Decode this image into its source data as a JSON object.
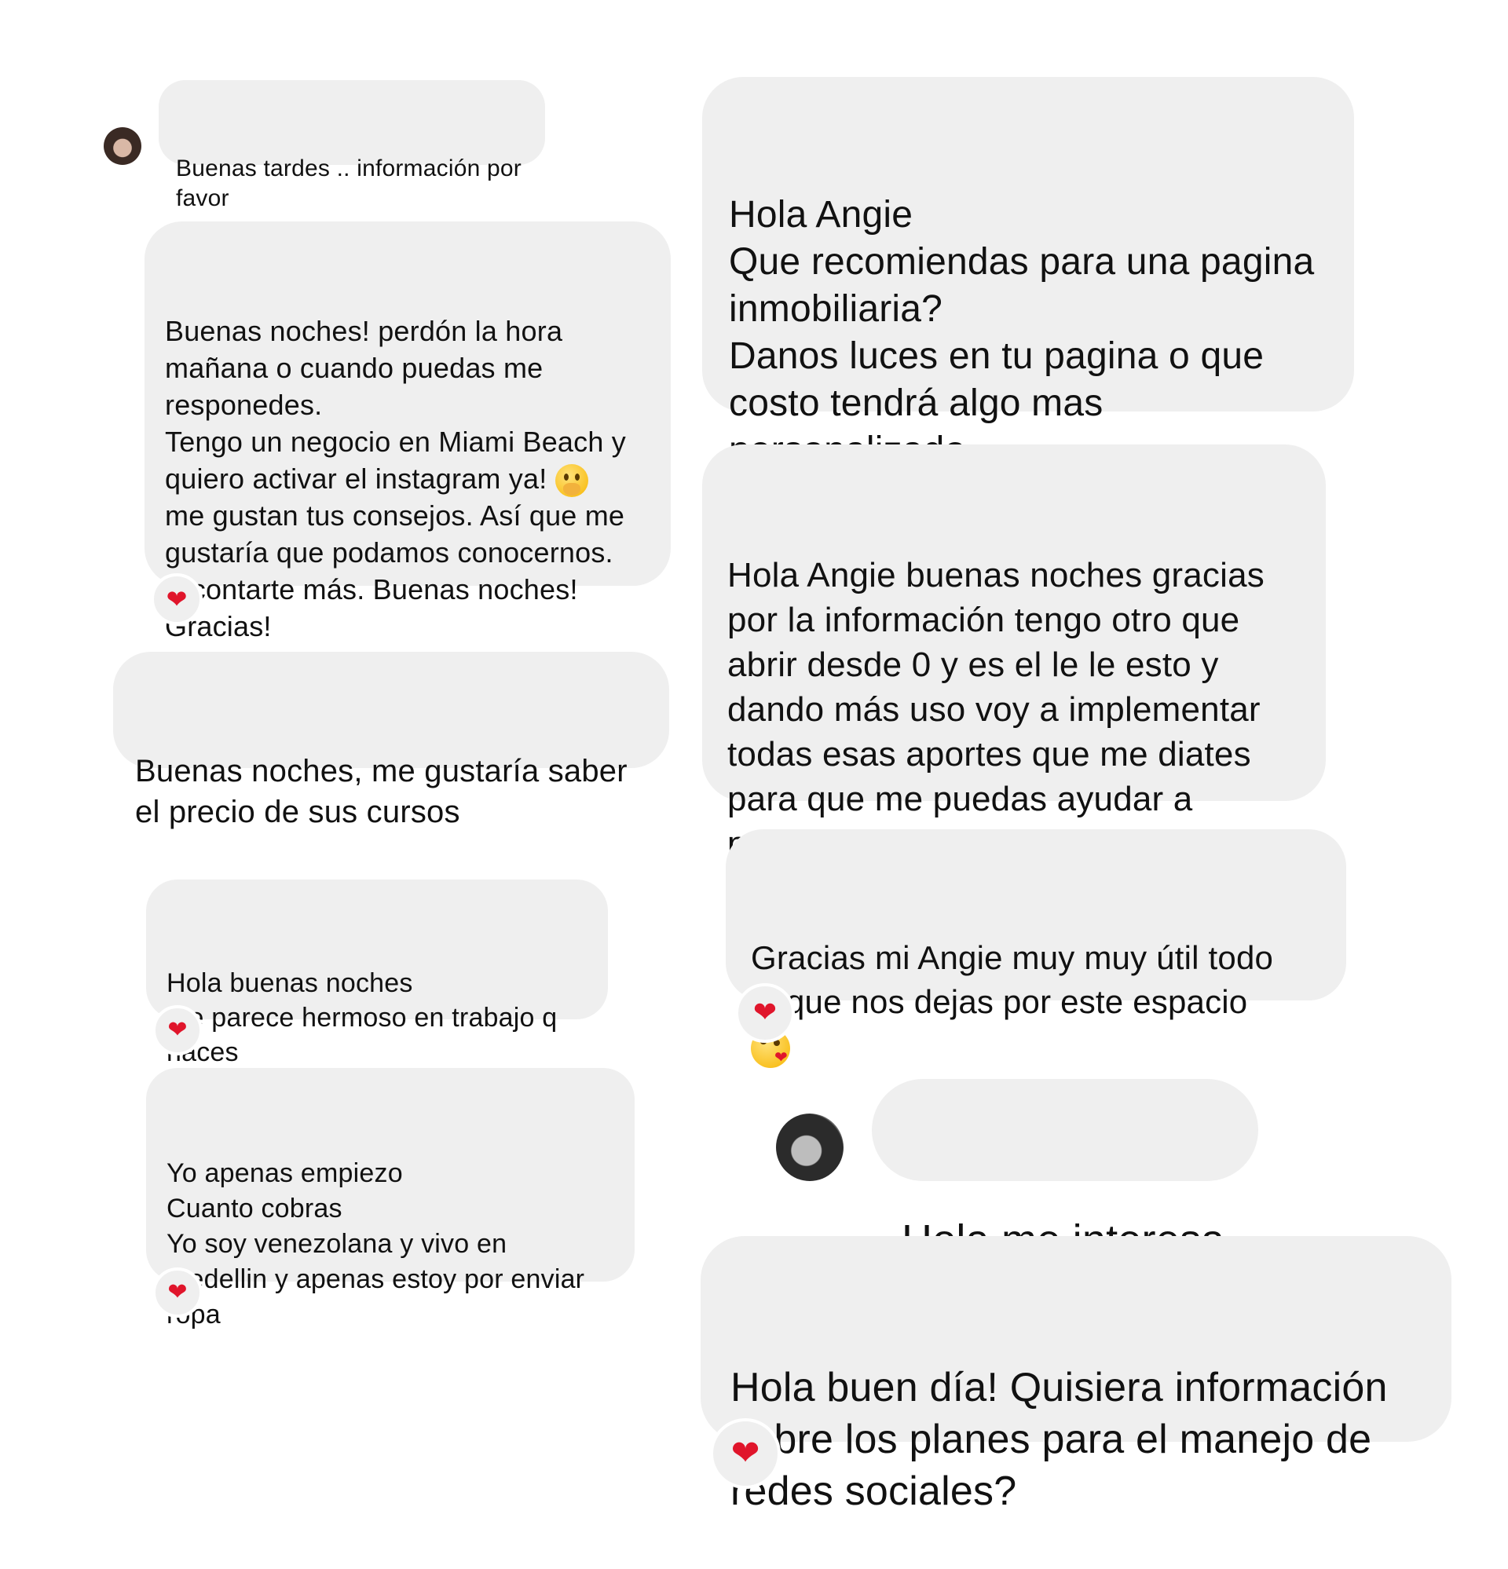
{
  "left_column": {
    "msg1": {
      "text": "Buenas tardes .. información por\nfavor"
    },
    "msg2": {
      "lines": [
        "Buenas noches! perdón la hora",
        "mañana o cuando puedas me",
        "responedes."
      ],
      "lines_b": [
        "Tengo un negocio en Miami Beach y",
        "quiero activar el instagram ya!"
      ],
      "lines_c": [
        "me gustan tus consejos. Así que me",
        "gustaría que podamos conocernos.",
        "Y contarte más. Buenas noches!",
        "Gracias!"
      ],
      "emoji": "hand-over-mouth-emoji",
      "reaction": "❤"
    },
    "msg3": {
      "text": "Buenas noches, me gustaría saber\nel precio de sus cursos"
    },
    "msg4": {
      "text": "Hola buenas noches\nMe parece hermoso en trabajo q\nhaces",
      "reaction": "❤"
    },
    "msg5": {
      "text": "Yo apenas empiezo\nCuanto cobras\nYo soy venezolana y vivo en\nmedellin y apenas estoy por enviar\nropa",
      "reaction": "❤"
    }
  },
  "right_column": {
    "msg1": {
      "text": "Hola Angie\nQue recomiendas para una pagina\ninmobiliaria?\nDanos luces en tu pagina o que\ncosto tendrá algo mas\npersonalizado"
    },
    "msg2": {
      "text": "Hola Angie buenas noches gracias\npor la información tengo otro que\nabrir desde 0 y es el le le esto y\ndando más uso voy a implementar\ntodas esas aportes que me diates\npara que me puedas ayudar a\npotenciar mis redes sociales."
    },
    "msg3": {
      "text": "Gracias mi Angie muy muy útil todo\nlo que nos dejas por este espacio",
      "emoji": "face-blowing-kiss-emoji",
      "reaction": "❤"
    },
    "msg4": {
      "text": "Hola me interesa"
    },
    "msg5": {
      "text": "Hola buen día! Quisiera información\nsobre los planes para el manejo de\nredes sociales?",
      "reaction": "❤"
    }
  }
}
